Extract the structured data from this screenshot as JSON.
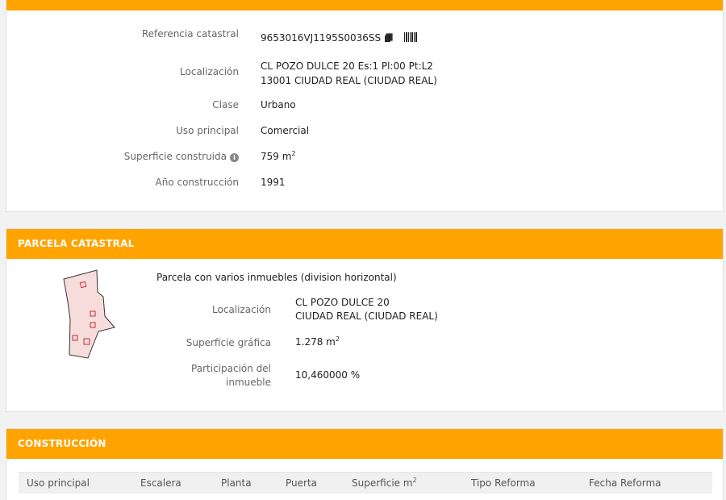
{
  "inmueble": {
    "referencia_label": "Referencia catastral",
    "referencia_value": "9653016VJ1195S0036SS",
    "localizacion_label": "Localización",
    "localizacion_line1": "CL POZO DULCE 20 Es:1 Pl:00 Pt:L2",
    "localizacion_line2": "13001 CIUDAD REAL (CIUDAD REAL)",
    "clase_label": "Clase",
    "clase_value": "Urbano",
    "uso_label": "Uso principal",
    "uso_value": "Comercial",
    "superficie_label": "Superficie construida",
    "superficie_value": "759 m",
    "superficie_exp": "2",
    "anio_label": "Año construcción",
    "anio_value": "1991"
  },
  "parcela": {
    "header": "PARCELA CATASTRAL",
    "title": "Parcela con varios inmuebles (division horizontal)",
    "localizacion_label": "Localización",
    "localizacion_line1": "CL POZO DULCE 20",
    "localizacion_line2": "CIUDAD REAL (CIUDAD REAL)",
    "superficie_label": "Superficie gráfica",
    "superficie_value": "1.278 m",
    "superficie_exp": "2",
    "participacion_label_1": "Participación del",
    "participacion_label_2": "inmueble",
    "participacion_value": "10,460000 %"
  },
  "construccion": {
    "header": "CONSTRUCCIÓN",
    "columns": [
      "Uso principal",
      "Escalera",
      "Planta",
      "Puerta",
      "Superficie m",
      "Tipo Reforma",
      "Fecha Reforma"
    ],
    "superficie_exp": "2"
  },
  "colors": {
    "accent": "#ffa300",
    "parcel_fill": "#f7dcdc",
    "parcel_stroke": "#333333",
    "parcel_mark": "#c0303a"
  }
}
